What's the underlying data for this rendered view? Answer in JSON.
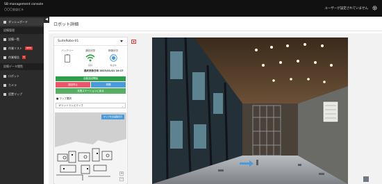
{
  "header": {
    "brand_line1": "SB management console",
    "brand_line2": "〇〇〇支店ビル",
    "user_status": "ユーザーが設定されていません"
  },
  "sidebar": {
    "items": [
      {
        "label": "ダッシュボード"
      },
      {
        "label": "設備管理",
        "section": true
      },
      {
        "label": "設備一覧"
      },
      {
        "label": "作業リスト",
        "badge": "NEW"
      },
      {
        "label": "作業報告",
        "badge": "3"
      },
      {
        "label": "設備データ閲覧",
        "section": true
      },
      {
        "label": "ロボット"
      },
      {
        "label": "カメラ"
      },
      {
        "label": "設置マップ"
      }
    ]
  },
  "page": {
    "title": "ロボット詳細"
  },
  "panel": {
    "robot_name": "SuiteRobo-01",
    "stats": [
      {
        "label": "バッテリー",
        "sub": "-"
      },
      {
        "label": "通信状態",
        "sub": "良好"
      },
      {
        "label": "稼働状況",
        "sub": "停止中"
      }
    ],
    "updated": "最終更新日時 2023/01/01 10:17",
    "buttons": {
      "start": "自動巡回開始",
      "stop": "巡回停止",
      "resume": "再開",
      "home": "充電ステーションに戻る"
    },
    "map_select_label": "■ マップ選択",
    "map_select_value": "1Fエントランスマップ",
    "map_button": "マップを全画面表示",
    "zoom_in": "+",
    "zoom_out": "−"
  },
  "colors": {
    "topbar": "#111111",
    "sidebar": "#2b2b2b",
    "green": "#2e9e48",
    "pink": "#e8576b",
    "blue": "#4a9bd8",
    "badge_red": "#e53935"
  },
  "icons": [
    "gear-icon",
    "collapse-arrow-icon",
    "battery-icon",
    "wifi-icon",
    "robot-status-icon",
    "panorama-icon",
    "fullscreen-icon"
  ]
}
